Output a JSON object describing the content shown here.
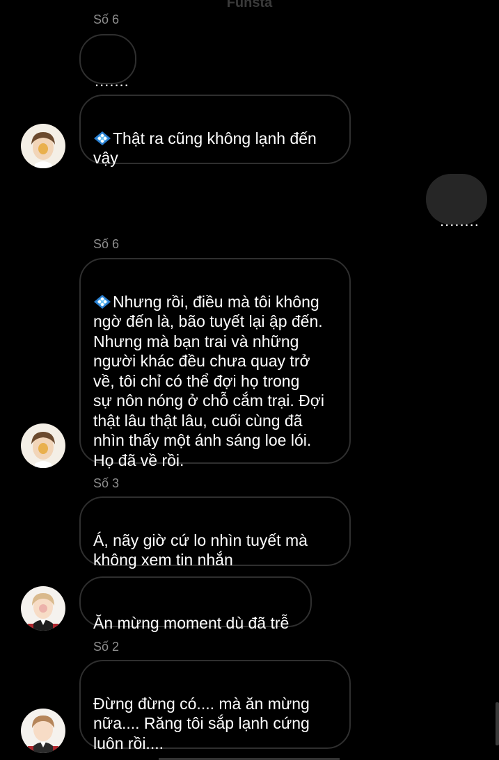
{
  "header": {
    "title": "Funsta"
  },
  "messages": [
    {
      "sender": "Số 6",
      "text": "......."
    },
    {
      "gem_icon": "diamond-sparkle-icon",
      "text": "Thật ra cũng không lạnh đến\nvậy"
    },
    {
      "outgoing": true,
      "text": "........"
    },
    {
      "sender": "Số 6",
      "gem_icon": "diamond-sparkle-icon",
      "text": "Nhưng rồi, điều mà tôi không\nngờ đến là, bão tuyết lại ập đến.\nNhưng mà bạn trai và những\nngười khác đều chưa quay trở\nvề, tôi chỉ có thể đợi họ trong\nsự nôn nóng ở chỗ cắm trại. Đợi\nthật lâu thật lâu, cuối cùng đã\nnhìn thấy một ánh sáng loe lói.\nHọ đã về rồi."
    },
    {
      "sender": "Số 3",
      "text": "Á, nãy giờ cứ lo nhìn tuyết mà\nkhông xem tin nhắn"
    },
    {
      "text": "Ăn mừng moment dù đã trễ"
    },
    {
      "sender": "Số 2",
      "text": "Đừng đừng có.... mà ăn mừng\nnữa.... Răng tôi sắp lạnh cứng\nluôn rồi...."
    }
  ],
  "colors": {
    "background": "#000000",
    "incoming_border": "#2f2f2f",
    "outgoing_bubble": "#262626",
    "sender_name": "#8e8e8e",
    "gem": "#4aa3e0"
  }
}
